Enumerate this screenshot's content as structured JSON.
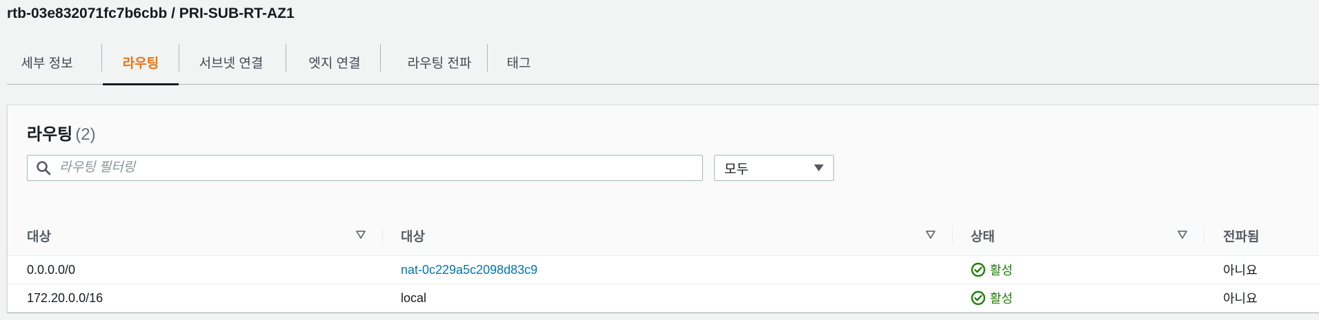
{
  "header": {
    "title": "rtb-03e832071fc7b6cbb / PRI-SUB-RT-AZ1"
  },
  "tabs": [
    {
      "label": "세부 정보",
      "active": false
    },
    {
      "label": "라우팅",
      "active": true
    },
    {
      "label": "서브넷 연결",
      "active": false
    },
    {
      "label": "엣지 연결",
      "active": false
    },
    {
      "label": "라우팅 전파",
      "active": false
    },
    {
      "label": "태그",
      "active": false
    }
  ],
  "routes": {
    "title": "라우팅",
    "count": "(2)",
    "filter_placeholder": "라우팅 필터링",
    "select_value": "모두",
    "columns": [
      "대상",
      "대상",
      "상태",
      "전파됨"
    ],
    "rows": [
      {
        "destination": "0.0.0.0/0",
        "target": "nat-0c229a5c2098d83c9",
        "target_link": true,
        "status": "활성",
        "propagated": "아니요"
      },
      {
        "destination": "172.20.0.0/16",
        "target": "local",
        "target_link": false,
        "status": "활성",
        "propagated": "아니요"
      }
    ]
  },
  "colors": {
    "accent": "#ec7211",
    "link": "#0073bb",
    "success": "#1d8102"
  }
}
